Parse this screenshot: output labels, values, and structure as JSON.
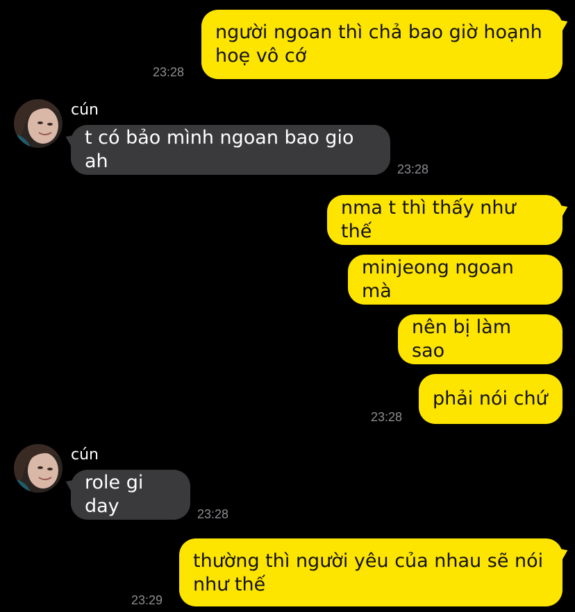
{
  "chat": {
    "messages": [
      {
        "direction": "out",
        "text": "người ngoan thì chả bao giờ hoạnh\nhoẹ vô cớ",
        "time": "23:28"
      },
      {
        "direction": "in",
        "sender": "cún",
        "text": "t có bảo mình ngoan bao gio ah",
        "time": "23:28"
      },
      {
        "direction": "out",
        "text": "nma t thì thấy như thế"
      },
      {
        "direction": "out",
        "text": "minjeong ngoan mà"
      },
      {
        "direction": "out",
        "text": "nên bị làm sao"
      },
      {
        "direction": "out",
        "text": "phải nói chứ",
        "time": "23:28"
      },
      {
        "direction": "in",
        "sender": "cún",
        "text": "role gi day",
        "time": "23:28"
      },
      {
        "direction": "out",
        "text": "thường thì người yêu của nhau sẽ nói\nnhư thế",
        "time": "23:29"
      }
    ]
  },
  "colors": {
    "background": "#000000",
    "outgoing_bubble": "#FEE500",
    "incoming_bubble": "#3A3A3C",
    "timestamp": "#8E8E93"
  },
  "icons": {
    "avatar": "contact-avatar-photo"
  }
}
